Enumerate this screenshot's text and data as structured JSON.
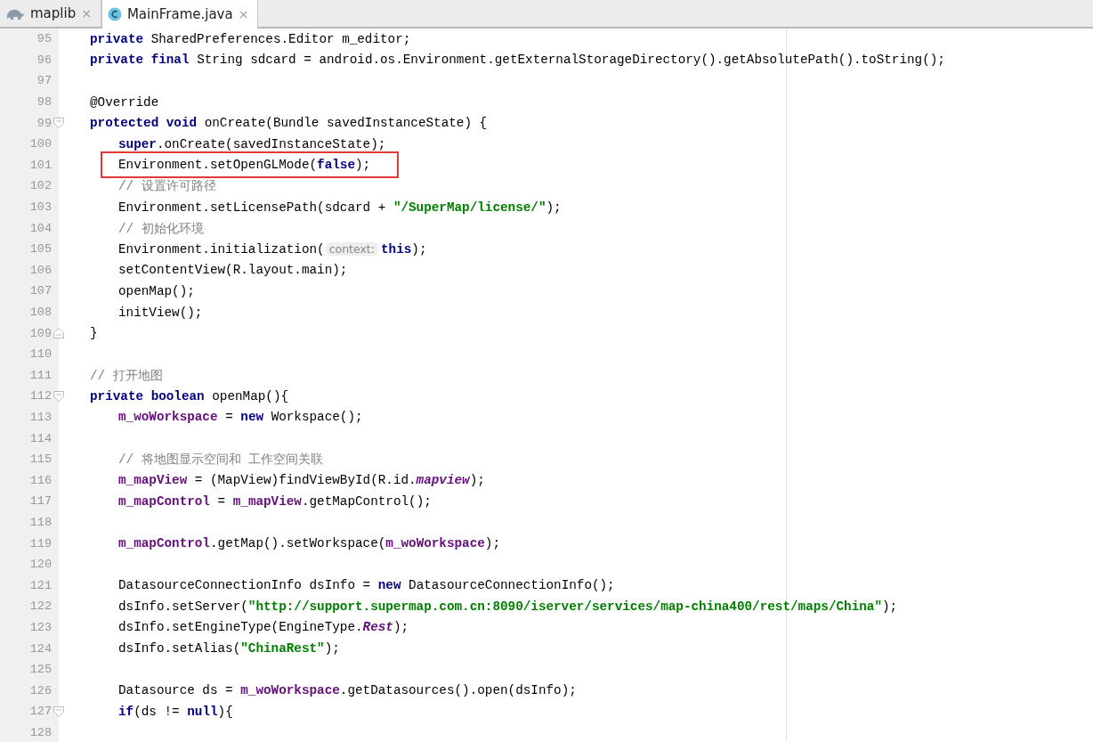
{
  "tabs": [
    {
      "label": "maplib",
      "kind": "module",
      "selected": false,
      "close": "×"
    },
    {
      "label": "MainFrame.java",
      "kind": "class",
      "selected": true,
      "close": "×"
    }
  ],
  "lines": [
    {
      "number": "95",
      "tokens": [
        {
          "kind": "kw",
          "text": "private"
        },
        {
          "kind": "plain",
          "text": " SharedPreferences.Editor m_editor;"
        }
      ]
    },
    {
      "number": "96",
      "tokens": [
        {
          "kind": "kw",
          "text": "private final"
        },
        {
          "kind": "plain",
          "text": " String sdcard = android.os.Environment.getExternalStorageDirectory().getAbsolutePath().toString();"
        }
      ]
    },
    {
      "number": "97"
    },
    {
      "number": "98",
      "tokens": [
        {
          "kind": "plain",
          "text": "@Override"
        }
      ]
    },
    {
      "number": "99",
      "expanded": true,
      "tokens": [
        {
          "kind": "kw",
          "text": "protected void"
        },
        {
          "kind": "plain",
          "text": " onCreate(Bundle savedInstanceState) {"
        }
      ],
      "children": [
        {
          "number": "100",
          "tokens": [
            {
              "kind": "kw",
              "text": "super"
            },
            {
              "kind": "plain",
              "text": ".onCreate(savedInstanceState);"
            }
          ]
        },
        {
          "number": "101",
          "boxed": true,
          "tokens": [
            {
              "kind": "plain",
              "text": "Environment.setOpenGLMode("
            },
            {
              "kind": "kw",
              "text": "false"
            },
            {
              "kind": "plain",
              "text": ");"
            }
          ]
        },
        {
          "number": "102",
          "tokens": [
            {
              "kind": "comment",
              "text": "// 设置许可路径"
            }
          ]
        },
        {
          "number": "103",
          "tokens": [
            {
              "kind": "plain",
              "text": "Environment.setLicensePath(sdcard + "
            },
            {
              "kind": "str",
              "text": "\"/SuperMap/license/\""
            },
            {
              "kind": "plain",
              "text": ");"
            }
          ]
        },
        {
          "number": "104",
          "tokens": [
            {
              "kind": "comment",
              "text": "// 初始化环境"
            }
          ]
        },
        {
          "number": "105",
          "tokens": [
            {
              "kind": "plain",
              "text": "Environment.initialization("
            },
            {
              "kind": "hint",
              "text": "context:"
            },
            {
              "kind": "kw",
              "text": "this"
            },
            {
              "kind": "plain",
              "text": ");"
            }
          ]
        },
        {
          "number": "106",
          "tokens": [
            {
              "kind": "plain",
              "text": "setContentView(R.layout.main);"
            }
          ]
        },
        {
          "number": "107",
          "tokens": [
            {
              "kind": "plain",
              "text": "openMap();"
            }
          ]
        },
        {
          "number": "108",
          "tokens": [
            {
              "kind": "plain",
              "text": "initView();"
            }
          ]
        }
      ]
    },
    {
      "number": "109",
      "fold_end": true,
      "tokens": [
        {
          "kind": "plain",
          "text": "}"
        }
      ]
    },
    {
      "number": "110"
    },
    {
      "number": "111",
      "tokens": [
        {
          "kind": "comment",
          "text": "// 打开地图"
        }
      ]
    },
    {
      "number": "112",
      "expanded": true,
      "tokens": [
        {
          "kind": "kw",
          "text": "private boolean"
        },
        {
          "kind": "plain",
          "text": " openMap(){"
        }
      ],
      "children": [
        {
          "number": "113",
          "tokens": [
            {
              "kind": "field",
              "text": "m_woWorkspace"
            },
            {
              "kind": "plain",
              "text": " = "
            },
            {
              "kind": "kw",
              "text": "new"
            },
            {
              "kind": "plain",
              "text": " Workspace();"
            }
          ]
        },
        {
          "number": "114"
        },
        {
          "number": "115",
          "tokens": [
            {
              "kind": "comment",
              "text": "// 将地图显示空间和 工作空间关联"
            }
          ]
        },
        {
          "number": "116",
          "tokens": [
            {
              "kind": "field",
              "text": "m_mapView"
            },
            {
              "kind": "plain",
              "text": " = (MapView)findViewById(R.id."
            },
            {
              "kind": "static",
              "text": "mapview"
            },
            {
              "kind": "plain",
              "text": ");"
            }
          ]
        },
        {
          "number": "117",
          "tokens": [
            {
              "kind": "field",
              "text": "m_mapControl"
            },
            {
              "kind": "plain",
              "text": " = "
            },
            {
              "kind": "field",
              "text": "m_mapView"
            },
            {
              "kind": "plain",
              "text": ".getMapControl();"
            }
          ]
        },
        {
          "number": "118"
        },
        {
          "number": "119",
          "tokens": [
            {
              "kind": "field",
              "text": "m_mapControl"
            },
            {
              "kind": "plain",
              "text": ".getMap().setWorkspace("
            },
            {
              "kind": "field",
              "text": "m_woWorkspace"
            },
            {
              "kind": "plain",
              "text": ");"
            }
          ]
        },
        {
          "number": "120"
        },
        {
          "number": "121",
          "tokens": [
            {
              "kind": "plain",
              "text": "DatasourceConnectionInfo dsInfo = "
            },
            {
              "kind": "kw",
              "text": "new"
            },
            {
              "kind": "plain",
              "text": " DatasourceConnectionInfo();"
            }
          ]
        },
        {
          "number": "122",
          "tokens": [
            {
              "kind": "plain",
              "text": "dsInfo.setServer("
            },
            {
              "kind": "str",
              "text": "\"http://support.supermap.com.cn:8090/iserver/services/map-china400/rest/maps/China\""
            },
            {
              "kind": "plain",
              "text": ");"
            }
          ]
        },
        {
          "number": "123",
          "tokens": [
            {
              "kind": "plain",
              "text": "dsInfo.setEngineType(EngineType."
            },
            {
              "kind": "static",
              "text": "Rest"
            },
            {
              "kind": "plain",
              "text": ");"
            }
          ]
        },
        {
          "number": "124",
          "tokens": [
            {
              "kind": "plain",
              "text": "dsInfo.setAlias("
            },
            {
              "kind": "str",
              "text": "\"ChinaRest\""
            },
            {
              "kind": "plain",
              "text": ");"
            }
          ]
        },
        {
          "number": "125"
        },
        {
          "number": "126",
          "tokens": [
            {
              "kind": "plain",
              "text": "Datasource ds = "
            },
            {
              "kind": "field",
              "text": "m_woWorkspace"
            },
            {
              "kind": "plain",
              "text": ".getDatasources().open(dsInfo);"
            }
          ]
        },
        {
          "number": "127",
          "expanded": true,
          "tokens": [
            {
              "kind": "kw",
              "text": "if"
            },
            {
              "kind": "plain",
              "text": "(ds != "
            },
            {
              "kind": "kw",
              "text": "null"
            },
            {
              "kind": "plain",
              "text": "){"
            }
          ],
          "children": [
            {
              "number": "128"
            }
          ]
        }
      ]
    }
  ]
}
